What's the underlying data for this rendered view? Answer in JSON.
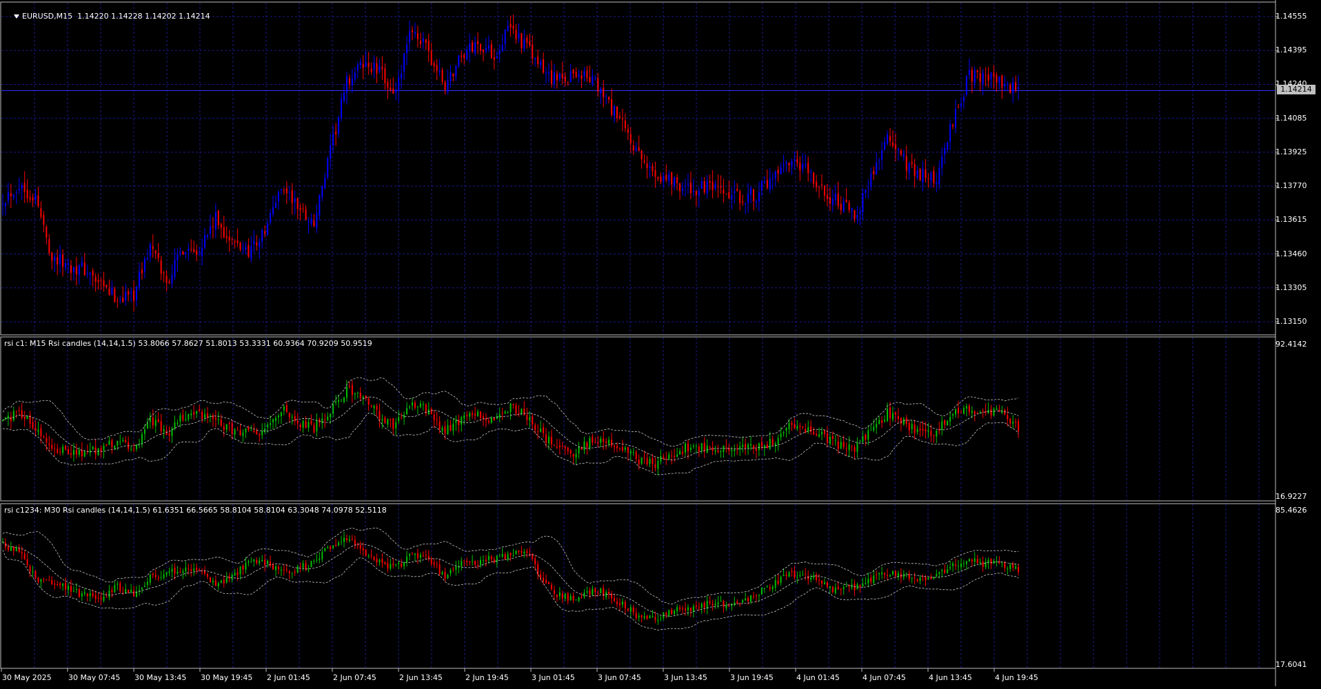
{
  "main_panel": {
    "title": "EURUSD,M15  1.14220 1.14228 1.14202 1.14214",
    "symbol_menu_icon": "triangle-down-icon",
    "current_price": "1.14214",
    "price_labels": [
      "1.14555",
      "1.14395",
      "1.14240",
      "1.14085",
      "1.13925",
      "1.13770",
      "1.13615",
      "1.13460",
      "1.13305",
      "1.13150"
    ],
    "colors": {
      "bull": "#0000ff",
      "bear": "#ff0000",
      "grid": "#1a1a8c",
      "background": "#000000"
    }
  },
  "rsi1_panel": {
    "title": "rsi c1: M15 Rsi candles (14,14,1.5) 53.8066 57.8627 51.8013 53.3331 60.9364 70.9209 50.9519",
    "scale_top": "92.4142",
    "scale_bottom": "16.9227",
    "colors": {
      "bull": "#00c000",
      "bear": "#ff0000"
    }
  },
  "rsi2_panel": {
    "title": "rsi c1234: M30 Rsi candles (14,14,1.5) 61.6351 66.5665 58.8104 58.8104 63.3048 74.0978 52.5118",
    "scale_top": "85.4626",
    "scale_bottom": "17.6041",
    "colors": {
      "bull": "#00c000",
      "bear": "#ff0000"
    }
  },
  "time_axis": {
    "labels": [
      "30 May 2025",
      "30 May 07:45",
      "30 May 13:45",
      "30 May 19:45",
      "2 Jun 01:45",
      "2 Jun 07:45",
      "2 Jun 13:45",
      "2 Jun 19:45",
      "3 Jun 01:45",
      "3 Jun 07:45",
      "3 Jun 13:45",
      "3 Jun 19:45",
      "4 Jun 01:45",
      "4 Jun 07:45",
      "4 Jun 13:45",
      "4 Jun 19:45"
    ]
  },
  "chart_data": {
    "type": "candlestick",
    "symbol": "EURUSD",
    "timeframe": "M15",
    "price_close_path": [
      [
        0,
        1.1372
      ],
      [
        6,
        1.1378
      ],
      [
        12,
        1.1372
      ],
      [
        18,
        1.1345
      ],
      [
        24,
        1.1341
      ],
      [
        30,
        1.1339
      ],
      [
        36,
        1.1331
      ],
      [
        42,
        1.1326
      ],
      [
        48,
        1.1328
      ],
      [
        54,
        1.135
      ],
      [
        60,
        1.1333
      ],
      [
        66,
        1.1349
      ],
      [
        72,
        1.1349
      ],
      [
        78,
        1.1362
      ],
      [
        84,
        1.1351
      ],
      [
        90,
        1.1348
      ],
      [
        96,
        1.1356
      ],
      [
        102,
        1.1378
      ],
      [
        108,
        1.1368
      ],
      [
        114,
        1.136
      ],
      [
        120,
        1.1393
      ],
      [
        126,
        1.1425
      ],
      [
        132,
        1.1434
      ],
      [
        138,
        1.143
      ],
      [
        144,
        1.142
      ],
      [
        150,
        1.1451
      ],
      [
        156,
        1.1438
      ],
      [
        162,
        1.1423
      ],
      [
        168,
        1.1438
      ],
      [
        174,
        1.1443
      ],
      [
        180,
        1.1438
      ],
      [
        186,
        1.1451
      ],
      [
        192,
        1.1441
      ],
      [
        198,
        1.143
      ],
      [
        204,
        1.1426
      ],
      [
        210,
        1.143
      ],
      [
        216,
        1.1426
      ],
      [
        222,
        1.1415
      ],
      [
        228,
        1.1403
      ],
      [
        234,
        1.1388
      ],
      [
        240,
        1.1383
      ],
      [
        246,
        1.138
      ],
      [
        252,
        1.1375
      ],
      [
        258,
        1.1377
      ],
      [
        264,
        1.1373
      ],
      [
        270,
        1.1372
      ],
      [
        276,
        1.1374
      ],
      [
        282,
        1.138
      ],
      [
        288,
        1.1387
      ],
      [
        294,
        1.1385
      ],
      [
        300,
        1.1375
      ],
      [
        306,
        1.137
      ],
      [
        312,
        1.1363
      ],
      [
        318,
        1.1382
      ],
      [
        324,
        1.14
      ],
      [
        330,
        1.1389
      ],
      [
        336,
        1.1383
      ],
      [
        342,
        1.138
      ],
      [
        348,
        1.1408
      ],
      [
        354,
        1.1428
      ],
      [
        360,
        1.1429
      ],
      [
        366,
        1.1424
      ],
      [
        372,
        1.1421
      ]
    ],
    "rsi1_close_path": [
      [
        0,
        55
      ],
      [
        6,
        58
      ],
      [
        12,
        52
      ],
      [
        18,
        42
      ],
      [
        24,
        40
      ],
      [
        30,
        38
      ],
      [
        36,
        41
      ],
      [
        42,
        44
      ],
      [
        48,
        40
      ],
      [
        54,
        56
      ],
      [
        60,
        48
      ],
      [
        66,
        56
      ],
      [
        72,
        58
      ],
      [
        78,
        54
      ],
      [
        84,
        50
      ],
      [
        90,
        49
      ],
      [
        96,
        50
      ],
      [
        102,
        60
      ],
      [
        108,
        54
      ],
      [
        114,
        51
      ],
      [
        120,
        59
      ],
      [
        126,
        70
      ],
      [
        132,
        66
      ],
      [
        138,
        57
      ],
      [
        144,
        52
      ],
      [
        150,
        64
      ],
      [
        156,
        59
      ],
      [
        162,
        49
      ],
      [
        168,
        55
      ],
      [
        174,
        57
      ],
      [
        180,
        53
      ],
      [
        186,
        61
      ],
      [
        192,
        57
      ],
      [
        198,
        47
      ],
      [
        204,
        40
      ],
      [
        210,
        39
      ],
      [
        216,
        45
      ],
      [
        222,
        44
      ],
      [
        228,
        40
      ],
      [
        234,
        34
      ],
      [
        240,
        34
      ],
      [
        246,
        39
      ],
      [
        252,
        42
      ],
      [
        258,
        41
      ],
      [
        264,
        40
      ],
      [
        270,
        40
      ],
      [
        276,
        42
      ],
      [
        282,
        44
      ],
      [
        288,
        52
      ],
      [
        294,
        51
      ],
      [
        300,
        47
      ],
      [
        306,
        42
      ],
      [
        312,
        40
      ],
      [
        318,
        50
      ],
      [
        324,
        58
      ],
      [
        330,
        53
      ],
      [
        336,
        49
      ],
      [
        342,
        49
      ],
      [
        348,
        59
      ],
      [
        354,
        60
      ],
      [
        360,
        60
      ],
      [
        366,
        57
      ],
      [
        372,
        51
      ]
    ],
    "rsi2_close_path": [
      [
        0,
        70
      ],
      [
        6,
        67
      ],
      [
        12,
        55
      ],
      [
        18,
        53
      ],
      [
        24,
        51
      ],
      [
        30,
        48
      ],
      [
        36,
        47
      ],
      [
        42,
        52
      ],
      [
        48,
        49
      ],
      [
        54,
        56
      ],
      [
        60,
        58
      ],
      [
        66,
        60
      ],
      [
        72,
        58
      ],
      [
        78,
        54
      ],
      [
        84,
        56
      ],
      [
        90,
        62
      ],
      [
        96,
        63
      ],
      [
        102,
        59
      ],
      [
        108,
        60
      ],
      [
        114,
        62
      ],
      [
        120,
        70
      ],
      [
        126,
        73
      ],
      [
        132,
        68
      ],
      [
        138,
        63
      ],
      [
        144,
        60
      ],
      [
        150,
        67
      ],
      [
        156,
        64
      ],
      [
        162,
        56
      ],
      [
        168,
        62
      ],
      [
        174,
        63
      ],
      [
        180,
        64
      ],
      [
        186,
        66
      ],
      [
        192,
        66
      ],
      [
        198,
        55
      ],
      [
        204,
        48
      ],
      [
        210,
        47
      ],
      [
        216,
        50
      ],
      [
        222,
        49
      ],
      [
        228,
        43
      ],
      [
        234,
        38
      ],
      [
        240,
        39
      ],
      [
        246,
        42
      ],
      [
        252,
        42
      ],
      [
        258,
        45
      ],
      [
        264,
        44
      ],
      [
        270,
        45
      ],
      [
        276,
        49
      ],
      [
        282,
        53
      ],
      [
        288,
        58
      ],
      [
        294,
        57
      ],
      [
        300,
        54
      ],
      [
        306,
        50
      ],
      [
        312,
        52
      ],
      [
        318,
        55
      ],
      [
        324,
        58
      ],
      [
        330,
        57
      ],
      [
        336,
        55
      ],
      [
        342,
        56
      ],
      [
        348,
        62
      ],
      [
        354,
        63
      ],
      [
        360,
        62
      ],
      [
        366,
        62
      ],
      [
        372,
        60
      ]
    ],
    "bar_count": 375
  }
}
